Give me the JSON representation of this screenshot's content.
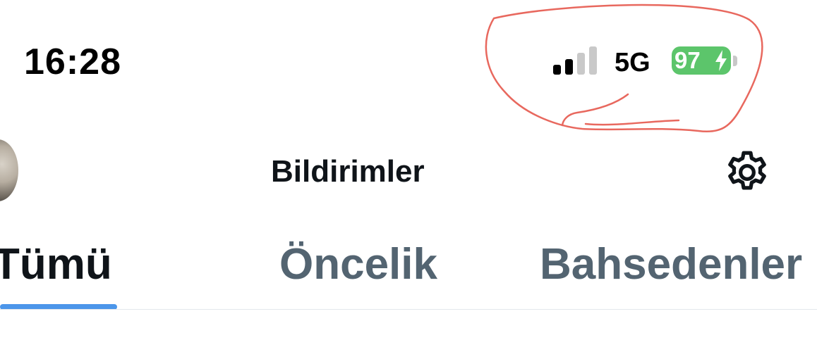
{
  "status_bar": {
    "time": "16:28",
    "signal_bars_active": 2,
    "signal_bars_total": 4,
    "network": "5G",
    "battery_percent": "97",
    "battery_color": "#5cc56b",
    "charging_icon": "bolt-icon"
  },
  "header": {
    "title": "Bildirimler",
    "avatar": "profile-avatar",
    "settings_icon": "gear-icon"
  },
  "tabs": [
    {
      "label": "Tümü",
      "selected": true
    },
    {
      "label": "Öncelik",
      "selected": false
    },
    {
      "label": "Bahsedenler",
      "selected": false
    }
  ],
  "colors": {
    "accent": "#4c96ea",
    "text_primary": "#0f1419",
    "text_secondary": "#536471",
    "annotation": "#e8685e"
  }
}
